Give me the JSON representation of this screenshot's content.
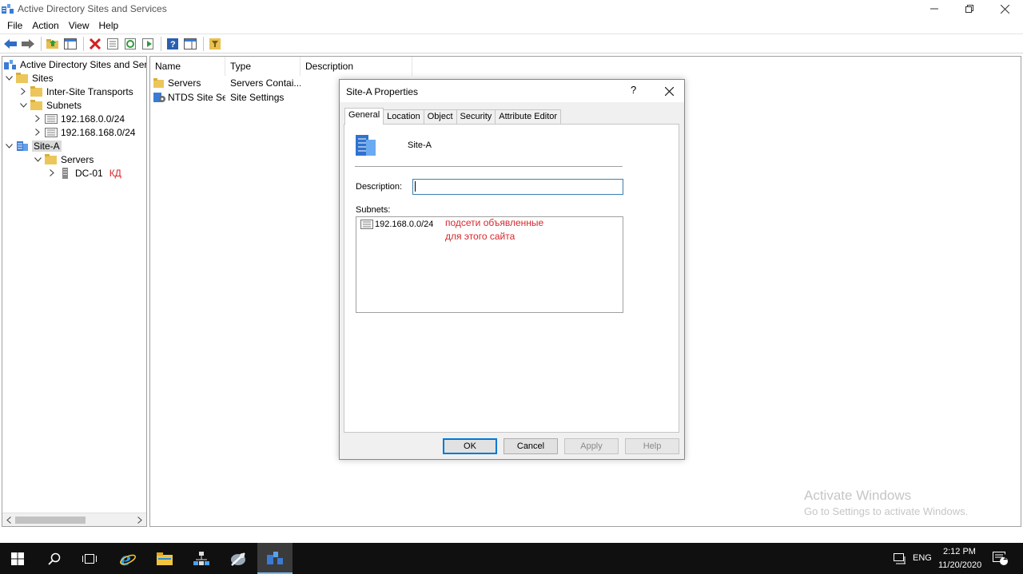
{
  "window": {
    "title": "Active Directory Sites and Services"
  },
  "menu": [
    "File",
    "Action",
    "View",
    "Help"
  ],
  "toolbar": {
    "icons": [
      "back-arrow-icon",
      "forward-arrow-icon",
      "up-folder-icon",
      "show-hide-tree-icon",
      "delete-icon",
      "properties-icon",
      "refresh-icon",
      "export-list-icon",
      "help-icon",
      "show-hide-action-pane-icon",
      "filter-icon"
    ]
  },
  "tree": {
    "root": "Active Directory Sites and Servic",
    "sites": "Sites",
    "inter_site": "Inter-Site Transports",
    "subnets": "Subnets",
    "subnet1": "192.168.0.0/24",
    "subnet2": "192.168.168.0/24",
    "site_a": "Site-A",
    "servers": "Servers",
    "dc01": "DC-01",
    "dc01_annotation": "КД"
  },
  "list": {
    "columns": [
      "Name",
      "Type",
      "Description"
    ],
    "rows": [
      {
        "name": "Servers",
        "type": "Servers Contai..."
      },
      {
        "name": "NTDS Site Se...",
        "type": "Site Settings"
      }
    ]
  },
  "dialog": {
    "title": "Site-A Properties",
    "help": "?",
    "tabs": [
      "General",
      "Location",
      "Object",
      "Security",
      "Attribute Editor"
    ],
    "active_tab": "General",
    "site_name": "Site-A",
    "description_label": "Description:",
    "description_value": "",
    "subnets_label": "Subnets:",
    "subnets": [
      "192.168.0.0/24"
    ],
    "subnets_annotation": "подсети объявленные для этого сайта",
    "buttons": {
      "ok": "OK",
      "cancel": "Cancel",
      "apply": "Apply",
      "help": "Help"
    }
  },
  "watermark": {
    "line1": "Activate Windows",
    "line2": "Go to Settings to activate Windows."
  },
  "taskbar": {
    "lang": "ENG",
    "time": "2:12 PM",
    "date": "11/20/2020",
    "notification_count": "1"
  },
  "colors": {
    "annotation": "#d7262b",
    "accent": "#0078d7",
    "taskbar": "#101010"
  }
}
